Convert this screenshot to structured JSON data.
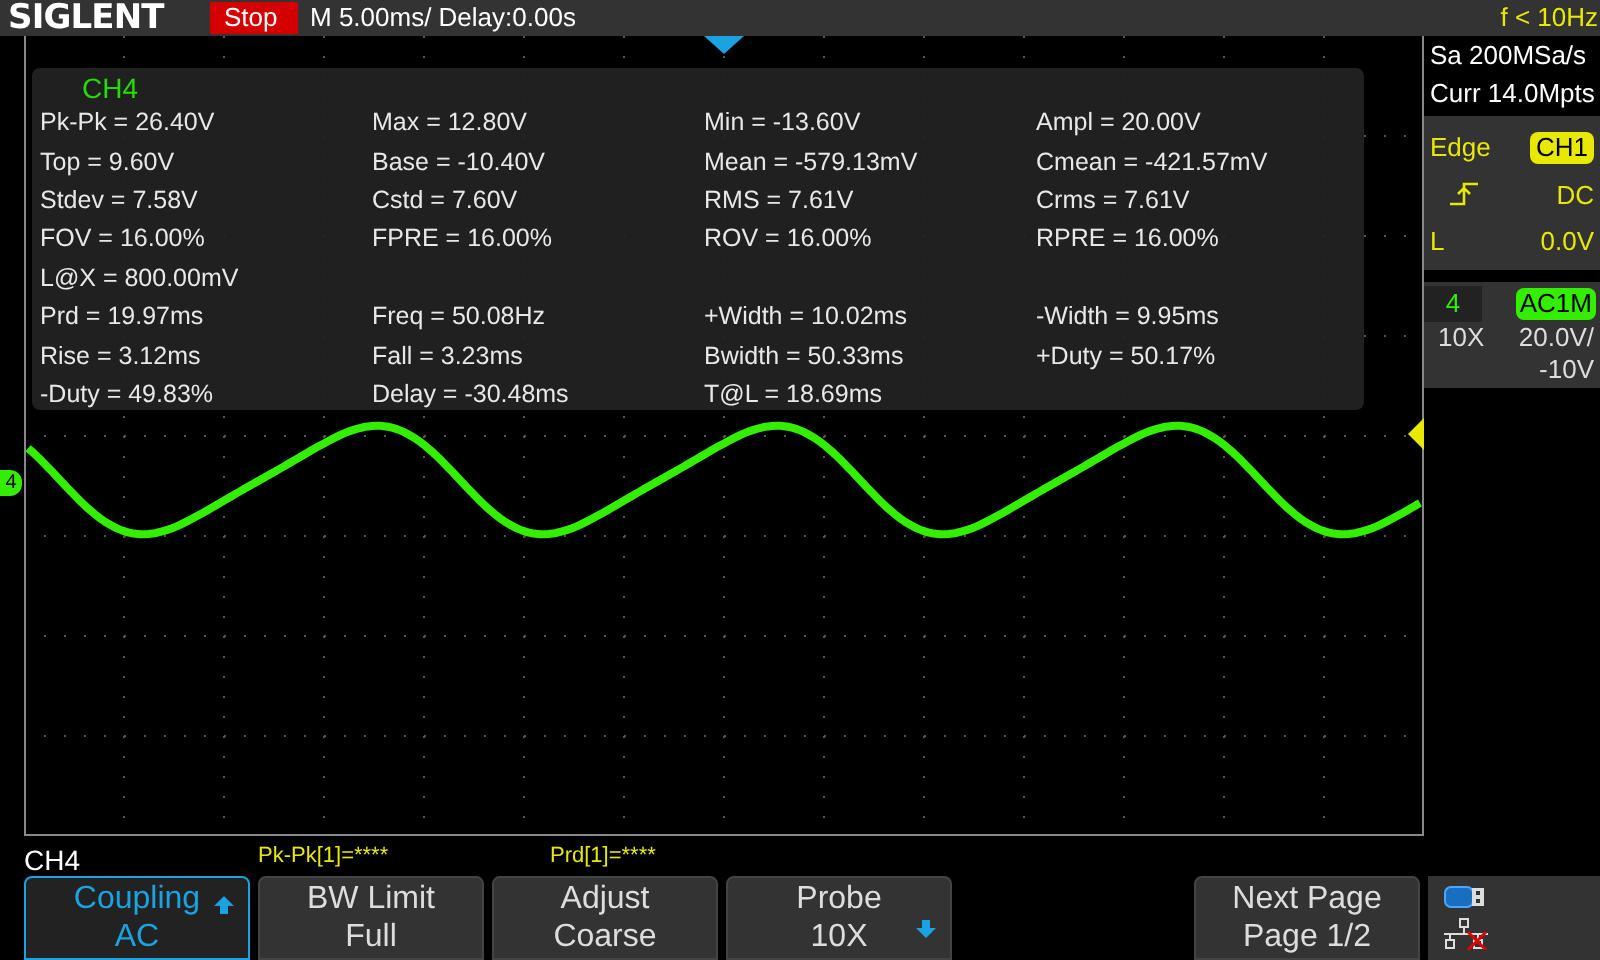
{
  "header": {
    "brand": "SIGLENT",
    "run_state": "Stop",
    "timebase": "M 5.00ms/ Delay:0.00s",
    "trigger_freq": "f < 10Hz"
  },
  "acquisition": {
    "sample_rate": "Sa 200MSa/s",
    "memory": "Curr 14.0Mpts"
  },
  "trigger": {
    "type": "Edge",
    "source": "CH1",
    "coupling": "DC",
    "level_label": "L",
    "level": "0.0V"
  },
  "channel": {
    "number": "4",
    "coupling": "AC1M",
    "probe": "10X",
    "scale": "20.0V/",
    "offset": "-10V"
  },
  "ground_marker": "4",
  "measurements": {
    "channel": "CH4",
    "rows": [
      [
        "Pk-Pk = 26.40V",
        "Max = 12.80V",
        "Min = -13.60V",
        "Ampl = 20.00V"
      ],
      [
        "Top = 9.60V",
        "Base = -10.40V",
        "Mean = -579.13mV",
        "Cmean = -421.57mV"
      ],
      [
        "Stdev = 7.58V",
        "Cstd = 7.60V",
        "RMS = 7.61V",
        "Crms = 7.61V"
      ],
      [
        "FOV = 16.00%",
        "FPRE = 16.00%",
        "ROV = 16.00%",
        "RPRE = 16.00%"
      ],
      [
        "L@X = 800.00mV"
      ],
      [
        "Prd = 19.97ms",
        "Freq = 50.08Hz",
        "+Width = 10.02ms",
        "-Width = 9.95ms"
      ],
      [
        "Rise = 3.12ms",
        "Fall = 3.23ms",
        "Bwidth = 50.33ms",
        "+Duty = 50.17%"
      ],
      [
        "-Duty = 49.83%",
        "Delay = -30.48ms",
        "T@L = 18.69ms"
      ]
    ]
  },
  "menu": {
    "title": "CH4",
    "readouts": [
      "Pk-Pk[1]=****",
      "Prd[1]=****"
    ],
    "buttons": [
      {
        "kind": "up",
        "label": "Coupling",
        "value": "AC",
        "selected": true
      },
      {
        "kind": "plain",
        "label": "BW Limit",
        "value": "Full",
        "selected": false
      },
      {
        "kind": "plain",
        "label": "Adjust",
        "value": "Coarse",
        "selected": false
      },
      {
        "kind": "down",
        "label": "Probe",
        "value": "10X",
        "selected": false
      }
    ],
    "next_page": {
      "label": "Next Page",
      "value": "Page 1/2"
    }
  }
}
